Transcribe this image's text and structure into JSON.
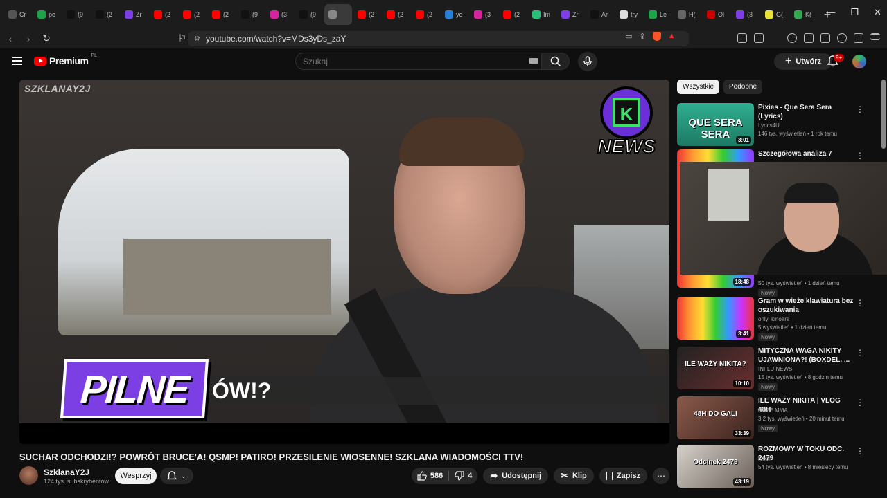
{
  "browser": {
    "tabs": [
      "Cr",
      "pe",
      "(9",
      "(2",
      "Zr",
      "(2",
      "(2",
      "(2",
      "(9",
      "(3",
      "(9",
      "",
      "(2",
      "(2",
      "(2",
      "ye",
      "(3",
      "(2",
      "Im",
      "Zr",
      "Ar",
      "try",
      "Le",
      "H(",
      "Ol",
      "(3",
      "G(",
      "K("
    ],
    "active_tab_index": 11,
    "url": "youtube.com/watch?v=MDs3yDs_zaY"
  },
  "header": {
    "logo_text": "Premium",
    "country": "PL",
    "search_placeholder": "Szukaj",
    "create_label": "Utwórz",
    "notifications_badge": "9+"
  },
  "player": {
    "watermark": "SZKLANAY2J",
    "badge_text": "NEWS",
    "badge_letter": "K",
    "pilne_text": "PILNE",
    "ticker_text": "ÓW!?"
  },
  "video": {
    "title": "SUCHAR ODCHODZI!? POWRÓT BRUCE'A! QSMP! PATIRO! PRZESILENIE WIOSENNE! SZKLANA WIADOMOŚCI TTV!",
    "channel": "SzklanaY2J",
    "subscribers": "124 tys. subskrybentów",
    "support_label": "Wesprzyj",
    "likes": "586",
    "dislikes": "4",
    "share_label": "Udostępnij",
    "clip_label": "Klip",
    "save_label": "Zapisz"
  },
  "sidebar": {
    "chips": [
      "Wszystkie",
      "Podobne"
    ],
    "recommendations": [
      {
        "title": "Pixies - Que Sera Sera (Lyrics)",
        "channel": "Lyrics4U",
        "stats": "146 tys. wyświetleń • 1 rok temu",
        "duration": "3:01",
        "thumb_text": "QUE SERA SERA",
        "new": ""
      },
      {
        "title": "Szczegółowa analiza 7",
        "channel": "",
        "stats": "50 tys. wyświetleń • 1 dzień temu",
        "duration": "18:48",
        "thumb_text": "",
        "new": "Nowy"
      },
      {
        "title": "Gram w wieże klawiatura bez oszukiwania",
        "channel": "only_kinoara",
        "stats": "5 wyświetleń • 1 dzień temu",
        "duration": "3:41",
        "thumb_text": "",
        "new": "Nowy"
      },
      {
        "title": "MITYCZNA WAGA NIKITY UJAWNIONA?! (BOXDEL, ...",
        "channel": "INFLU NEWS",
        "stats": "15 tys. wyświetleń • 8 godzin temu",
        "duration": "10:10",
        "thumb_text": "ILE WAŻY NIKITA?",
        "new": "Nowy"
      },
      {
        "title": "ILE WAŻY NIKITA | VLOG 48H",
        "channel": "FAME MMA",
        "stats": "3,2 tys. wyświetleń • 20 minut temu",
        "duration": "33:39",
        "thumb_text": "48H DO GALI",
        "new": "Nowy"
      },
      {
        "title": "ROZMOWY W TOKU ODC. 2479",
        "channel": "tvnpl",
        "stats": "54 tys. wyświetleń • 8 miesięcy temu",
        "duration": "43:19",
        "thumb_text": "Odcinek 2479",
        "new": ""
      }
    ]
  },
  "colors": {
    "yt_red": "#ff0000",
    "pilne_purple": "#7b3fe4",
    "background": "#0f0f0f"
  }
}
